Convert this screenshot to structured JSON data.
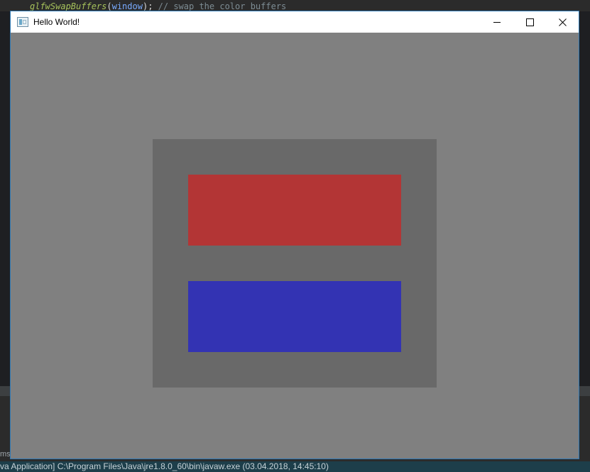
{
  "background_ide": {
    "code": {
      "fn": "glfwSwapBuffers",
      "open": "(",
      "arg": "window",
      "close": ");",
      "comment": "// swap the color buffers"
    },
    "console_tab_fragment": "ms",
    "console_launch_text": "va Application] C:\\Program Files\\Java\\jre1.8.0_60\\bin\\javaw.exe (03.04.2018, 14:45:10)"
  },
  "window": {
    "title": "Hello World!",
    "icon": "app-window-icon",
    "controls": [
      {
        "name": "minimize",
        "icon": "minimize-icon"
      },
      {
        "name": "maximize",
        "icon": "maximize-icon"
      },
      {
        "name": "close",
        "icon": "close-icon"
      }
    ]
  },
  "scene": {
    "clear_color": "#808080",
    "panel_color": "#696969",
    "shapes": [
      {
        "name": "red-rectangle",
        "color": "#b33535"
      },
      {
        "name": "blue-rectangle",
        "color": "#3333b3"
      }
    ]
  },
  "colors": {
    "window_border": "#2f79b5",
    "titlebar": "#ffffff"
  }
}
